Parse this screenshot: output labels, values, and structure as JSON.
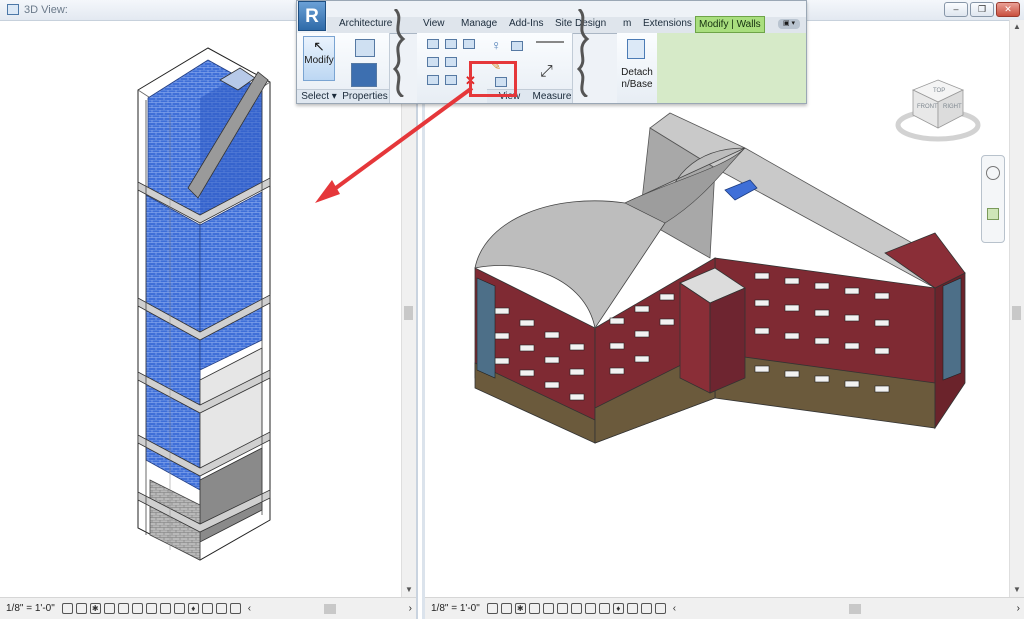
{
  "left_view": {
    "title": "3D View:",
    "scale": "1/8\" = 1'-0\""
  },
  "right_view": {
    "scale": "1/8\" = 1'-0\"",
    "viewcube": {
      "top": "TOP",
      "front": "FRONT",
      "right": "RIGHT"
    }
  },
  "ribbon": {
    "app_letter": "R",
    "tabs": [
      "Architecture",
      "View",
      "Manage",
      "Add-Ins",
      "Site Design",
      "m",
      "Extensions",
      "Modify | Walls"
    ],
    "active_tab": "Modify | Walls",
    "modify_label": "Modify",
    "panels": {
      "select": "Select",
      "properties": "Properties",
      "view": "View",
      "measure": "Measure",
      "detach_base": "n/Base"
    },
    "detach_label": "Detach"
  },
  "colors": {
    "accent_blue": "#3f6fd8",
    "callout_red": "#e5373a",
    "brick_red": "#7f2a33",
    "base_brown": "#6b5a3c",
    "roof_gray": "#b5b5b5",
    "active_tab_green": "#a9de7e"
  },
  "icons": [
    "revit-app-icon",
    "view-icon",
    "minimize-icon",
    "restore-icon",
    "close-icon",
    "cursor-icon",
    "properties-icon",
    "hide-element-icon",
    "measure-icon",
    "detach-icon",
    "viewcube-icon",
    "steering-wheel-icon",
    "zoom-icon"
  ]
}
